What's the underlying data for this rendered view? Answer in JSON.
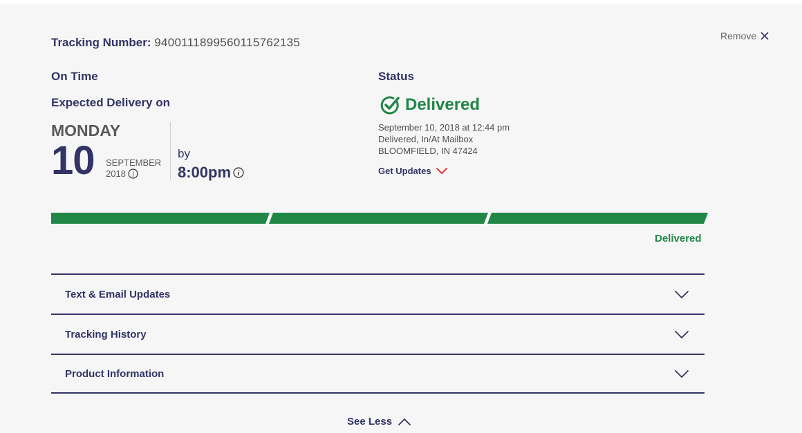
{
  "tracking": {
    "label": "Tracking Number:",
    "number": "9400111899560115762135"
  },
  "remove": {
    "label": "Remove",
    "icon": "close-icon"
  },
  "delivery": {
    "on_time": "On Time",
    "expected_label": "Expected Delivery on",
    "weekday": "MONDAY",
    "day": "10",
    "month": "SEPTEMBER",
    "year": "2018",
    "by_label": "by",
    "time": "8:00pm"
  },
  "status": {
    "heading": "Status",
    "main": "Delivered",
    "details": [
      "September 10, 2018 at 12:44 pm",
      "Delivered, In/At Mailbox",
      "BLOOMFIELD, IN 47424"
    ],
    "get_updates": "Get Updates"
  },
  "progress": {
    "segments_filled": 3,
    "segments_total": 3,
    "label": "Delivered",
    "color": "#218748"
  },
  "accordion": [
    {
      "title": "Text & Email Updates"
    },
    {
      "title": "Tracking History"
    },
    {
      "title": "Product Information"
    }
  ],
  "see_less": "See Less",
  "colors": {
    "navy": "#333366",
    "green": "#218748",
    "red": "#e71921",
    "background": "#f6f6f6"
  }
}
